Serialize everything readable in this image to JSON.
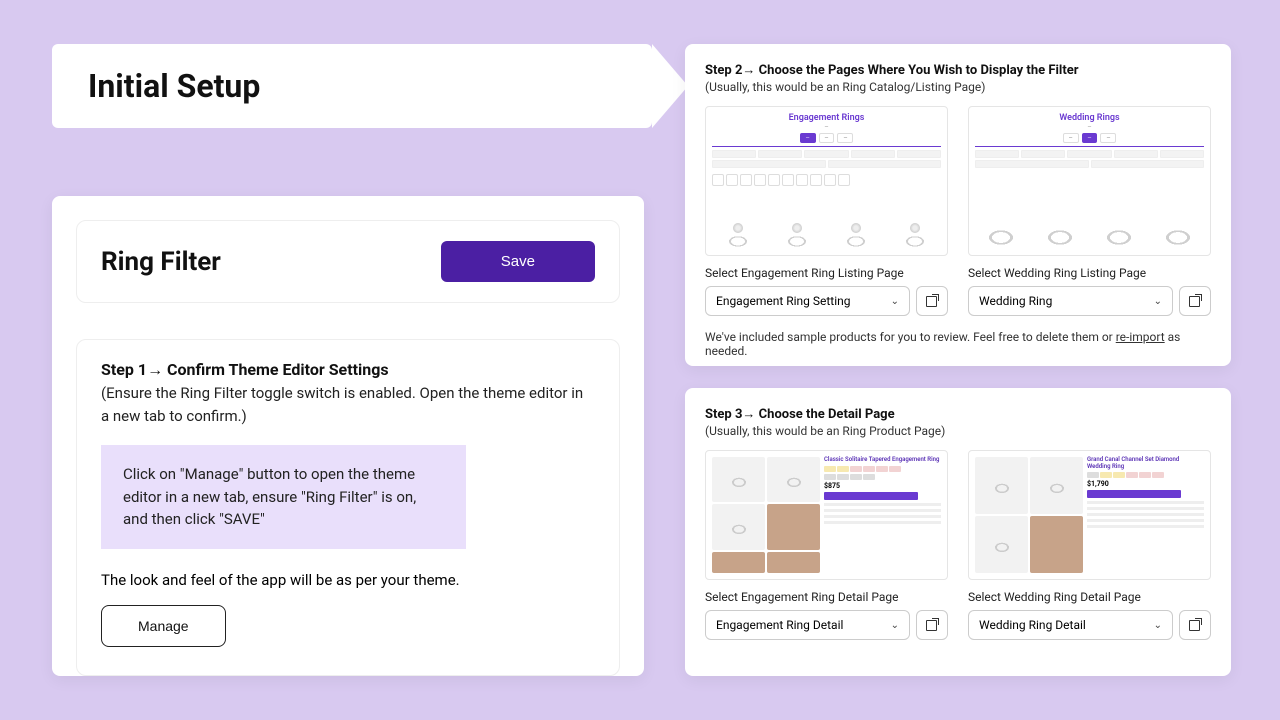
{
  "banner": {
    "title": "Initial Setup"
  },
  "ring_filter": {
    "heading": "Ring Filter",
    "save_label": "Save"
  },
  "step1": {
    "title": "Step 1→  Confirm Theme Editor Settings",
    "subtitle": "(Ensure the Ring Filter toggle switch is enabled. Open the theme editor in a new tab to confirm.)",
    "note": "Click on \"Manage\" button to open the theme editor in a new tab, ensure \"Ring Filter\" is on, and then click \"SAVE\"",
    "look_feel": "The look and feel of the app will be as per your theme.",
    "manage_label": "Manage"
  },
  "step2": {
    "title": "Step 2→ Choose the Pages Where You Wish to Display the Filter",
    "subtitle": "(Usually, this would be an Ring Catalog/Listing Page)",
    "left": {
      "preview_title": "Engagement Rings",
      "select_label": "Select Engagement Ring Listing Page",
      "select_value": "Engagement Ring Setting"
    },
    "right": {
      "preview_title": "Wedding Rings",
      "select_label": "Select Wedding Ring Listing Page",
      "select_value": "Wedding Ring"
    },
    "footnote_pre": "We've included sample products for you to review. Feel free to delete them or ",
    "footnote_link": "re-import",
    "footnote_post": " as needed."
  },
  "step3": {
    "title": "Step 3→ Choose the Detail Page",
    "subtitle": "(Usually, this would be an Ring Product Page)",
    "left": {
      "product_name": "Classic Solitaire Tapered Engagement Ring",
      "price": "$875",
      "select_label": "Select Engagement Ring Detail Page",
      "select_value": "Engagement Ring Detail"
    },
    "right": {
      "product_name": "Grand Canal Channel Set Diamond Wedding Ring",
      "price": "$1,790",
      "select_label": "Select Wedding Ring Detail Page",
      "select_value": "Wedding Ring Detail"
    }
  }
}
